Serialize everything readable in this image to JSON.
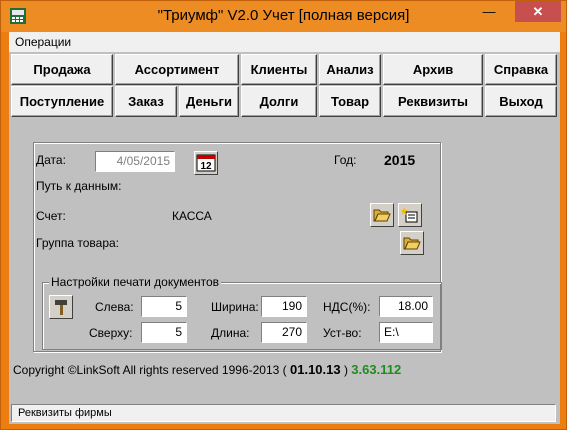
{
  "window": {
    "title": "\"Триумф\" V2.0 Учет [полная версия]",
    "minimize_glyph": "—",
    "maximize_glyph": "☐",
    "close_glyph": "✕",
    "accent": "#ed7d10",
    "close_color": "#c7504f"
  },
  "menu": {
    "operations": "Операции"
  },
  "toolbar": {
    "row1": [
      "Продажа",
      "Ассортимент",
      "Клиенты",
      "Анализ",
      "Архив",
      "Справка"
    ],
    "row2": [
      "Поступление",
      "Заказ",
      "Деньги",
      "Долги",
      "Товар",
      "Реквизиты",
      "Выход"
    ]
  },
  "form": {
    "date_label": "Дата:",
    "date_value": "4/05/2015",
    "calendar_icon_text": "12",
    "year_label": "Год:",
    "year_value": "2015",
    "data_path_label": "Путь к данным:",
    "account_label": "Счет:",
    "account_value": "КАССА",
    "group_label": "Группа товара:"
  },
  "print_settings": {
    "title": "Настройки печати документов",
    "left_label": "Слева:",
    "left_value": "5",
    "top_label": "Сверху:",
    "top_value": "5",
    "width_label": "Ширина:",
    "width_value": "190",
    "length_label": "Длина:",
    "length_value": "270",
    "vat_label": "НДС(%):",
    "vat_value": "18.00",
    "device_label": "Уст-во:",
    "device_value": "E:\\"
  },
  "footer": {
    "copyright": "Copyright ©LinkSoft All rights reserved 1996-2013 (",
    "date": "01.10.13",
    "close_paren": ")",
    "version": "3.63.112",
    "version_color": "#1e8c1e"
  },
  "status": {
    "text": "Реквизиты фирмы"
  },
  "icons": {
    "app": "app-icon",
    "calendar": "calendar-icon",
    "folder": "folder-open-icon",
    "new": "new-item-icon",
    "hammer": "hammer-icon"
  }
}
